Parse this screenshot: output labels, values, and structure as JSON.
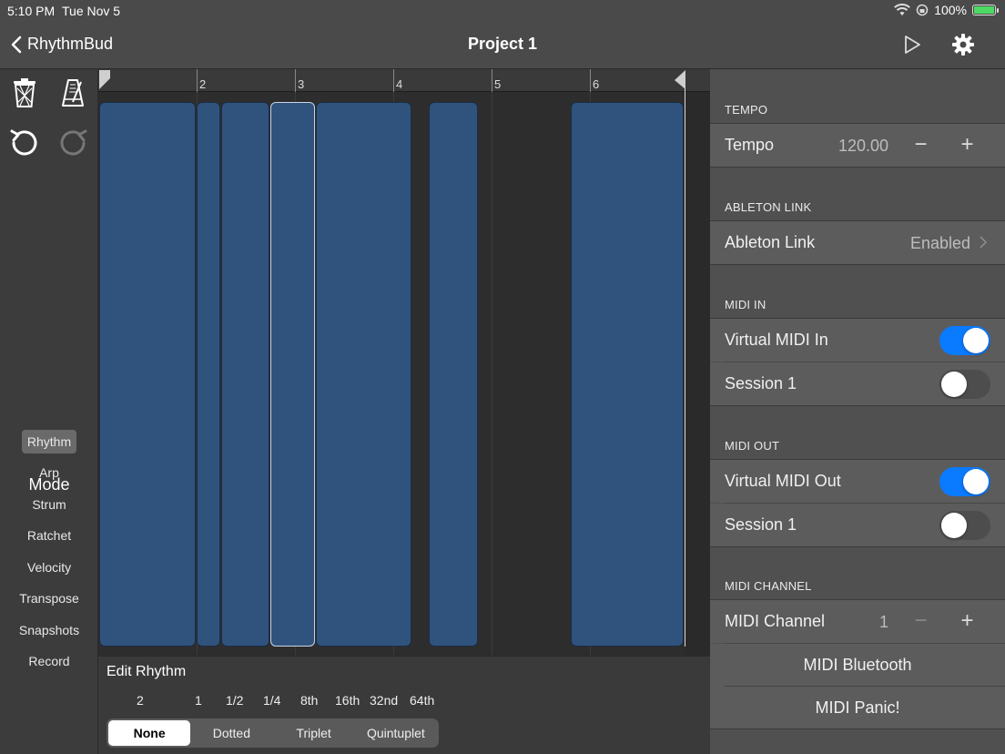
{
  "status": {
    "time": "5:10 PM",
    "date": "Tue Nov 5",
    "battery": "100%",
    "battery_level": 1.0
  },
  "nav": {
    "back_label": "RhythmBud",
    "title": "Project 1"
  },
  "tools": {
    "mode_title": "Mode"
  },
  "modes": [
    "Rhythm",
    "Arp",
    "Strum",
    "Ratchet",
    "Velocity",
    "Transpose",
    "Snapshots",
    "Record"
  ],
  "active_mode": "Rhythm",
  "ruler": {
    "labels": [
      "2",
      "3",
      "4",
      "5",
      "6"
    ]
  },
  "edit": {
    "title": "Edit Rhythm",
    "durations": [
      "2",
      "1",
      "1/2",
      "1/4",
      "8th",
      "16th",
      "32nd",
      "64th"
    ],
    "modifiers": [
      "None",
      "Dotted",
      "Triplet",
      "Quintuplet"
    ],
    "active_modifier": "None"
  },
  "settings": {
    "tempo": {
      "header": "TEMPO",
      "label": "Tempo",
      "value": "120.00",
      "minus": "−",
      "plus": "+"
    },
    "link": {
      "header": "ABLETON LINK",
      "label": "Ableton Link",
      "value": "Enabled"
    },
    "midi_in": {
      "header": "MIDI IN",
      "rows": [
        {
          "label": "Virtual MIDI In",
          "on": true
        },
        {
          "label": "Session 1",
          "on": false
        }
      ]
    },
    "midi_out": {
      "header": "MIDI OUT",
      "rows": [
        {
          "label": "Virtual MIDI Out",
          "on": true
        },
        {
          "label": "Session 1",
          "on": false
        }
      ]
    },
    "channel": {
      "header": "MIDI CHANNEL",
      "label": "MIDI Channel",
      "value": "1",
      "minus": "−",
      "plus": "+"
    },
    "bluetooth_label": "MIDI Bluetooth",
    "panic_label": "MIDI Panic!"
  },
  "colors": {
    "accent": "#0a7aff",
    "block": "#30537e",
    "battery": "#4cd964"
  }
}
